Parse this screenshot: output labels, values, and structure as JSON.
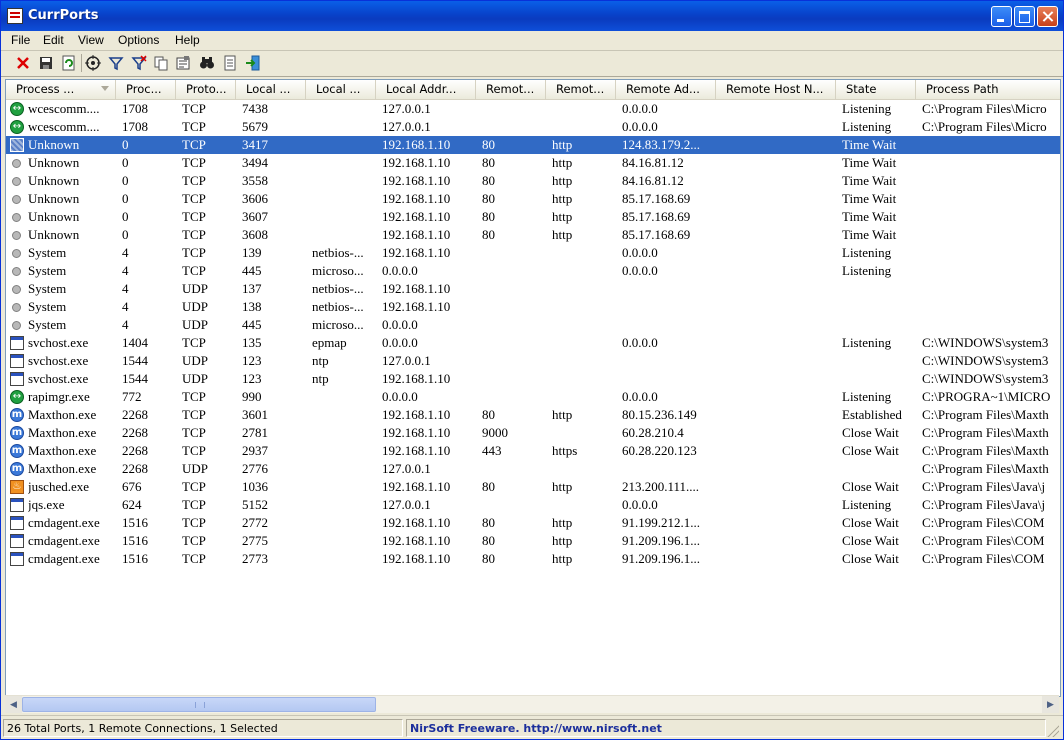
{
  "window": {
    "title": "CurrPorts"
  },
  "menu": [
    "File",
    "Edit",
    "View",
    "Options",
    "Help"
  ],
  "toolbar": [
    {
      "name": "close-connection-icon"
    },
    {
      "name": "save-icon"
    },
    {
      "name": "refresh-icon"
    },
    {
      "name": "target-icon"
    },
    {
      "name": "filter-icon"
    },
    {
      "name": "clear-filter-icon"
    },
    {
      "name": "copy-icon"
    },
    {
      "name": "properties-icon"
    },
    {
      "name": "find-icon"
    },
    {
      "name": "report-icon"
    },
    {
      "name": "exit-icon"
    }
  ],
  "columns": [
    "Process ...",
    "Proc...",
    "Proto...",
    "Local ...",
    "Local ...",
    "Local Addr...",
    "Remot...",
    "Remot...",
    "Remote Ad...",
    "Remote Host N...",
    "State",
    "Process Path"
  ],
  "rows": [
    {
      "icon": "green",
      "name": "wcescomm....",
      "pid": "1708",
      "proto": "TCP",
      "lport": "7438",
      "lpname": "",
      "laddr": "127.0.0.1",
      "rport": "",
      "rpname": "",
      "raddr": "0.0.0.0",
      "rhost": "",
      "state": "Listening",
      "path": "C:\\Program Files\\Micro"
    },
    {
      "icon": "green",
      "name": "wcescomm....",
      "pid": "1708",
      "proto": "TCP",
      "lport": "5679",
      "lpname": "",
      "laddr": "127.0.0.1",
      "rport": "",
      "rpname": "",
      "raddr": "0.0.0.0",
      "rhost": "",
      "state": "Listening",
      "path": "C:\\Program Files\\Micro"
    },
    {
      "icon": "unknown-sel",
      "name": "Unknown",
      "pid": "0",
      "proto": "TCP",
      "lport": "3417",
      "lpname": "",
      "laddr": "192.168.1.10",
      "rport": "80",
      "rpname": "http",
      "raddr": "124.83.179.2...",
      "rhost": "",
      "state": "Time Wait",
      "path": "",
      "selected": true
    },
    {
      "icon": "gray",
      "name": "Unknown",
      "pid": "0",
      "proto": "TCP",
      "lport": "3494",
      "lpname": "",
      "laddr": "192.168.1.10",
      "rport": "80",
      "rpname": "http",
      "raddr": "84.16.81.12",
      "rhost": "",
      "state": "Time Wait",
      "path": ""
    },
    {
      "icon": "gray",
      "name": "Unknown",
      "pid": "0",
      "proto": "TCP",
      "lport": "3558",
      "lpname": "",
      "laddr": "192.168.1.10",
      "rport": "80",
      "rpname": "http",
      "raddr": "84.16.81.12",
      "rhost": "",
      "state": "Time Wait",
      "path": ""
    },
    {
      "icon": "gray",
      "name": "Unknown",
      "pid": "0",
      "proto": "TCP",
      "lport": "3606",
      "lpname": "",
      "laddr": "192.168.1.10",
      "rport": "80",
      "rpname": "http",
      "raddr": "85.17.168.69",
      "rhost": "",
      "state": "Time Wait",
      "path": ""
    },
    {
      "icon": "gray",
      "name": "Unknown",
      "pid": "0",
      "proto": "TCP",
      "lport": "3607",
      "lpname": "",
      "laddr": "192.168.1.10",
      "rport": "80",
      "rpname": "http",
      "raddr": "85.17.168.69",
      "rhost": "",
      "state": "Time Wait",
      "path": ""
    },
    {
      "icon": "gray",
      "name": "Unknown",
      "pid": "0",
      "proto": "TCP",
      "lport": "3608",
      "lpname": "",
      "laddr": "192.168.1.10",
      "rport": "80",
      "rpname": "http",
      "raddr": "85.17.168.69",
      "rhost": "",
      "state": "Time Wait",
      "path": ""
    },
    {
      "icon": "gray",
      "name": "System",
      "pid": "4",
      "proto": "TCP",
      "lport": "139",
      "lpname": "netbios-...",
      "laddr": "192.168.1.10",
      "rport": "",
      "rpname": "",
      "raddr": "0.0.0.0",
      "rhost": "",
      "state": "Listening",
      "path": ""
    },
    {
      "icon": "gray",
      "name": "System",
      "pid": "4",
      "proto": "TCP",
      "lport": "445",
      "lpname": "microso...",
      "laddr": "0.0.0.0",
      "rport": "",
      "rpname": "",
      "raddr": "0.0.0.0",
      "rhost": "",
      "state": "Listening",
      "path": ""
    },
    {
      "icon": "gray",
      "name": "System",
      "pid": "4",
      "proto": "UDP",
      "lport": "137",
      "lpname": "netbios-...",
      "laddr": "192.168.1.10",
      "rport": "",
      "rpname": "",
      "raddr": "",
      "rhost": "",
      "state": "",
      "path": ""
    },
    {
      "icon": "gray",
      "name": "System",
      "pid": "4",
      "proto": "UDP",
      "lport": "138",
      "lpname": "netbios-...",
      "laddr": "192.168.1.10",
      "rport": "",
      "rpname": "",
      "raddr": "",
      "rhost": "",
      "state": "",
      "path": ""
    },
    {
      "icon": "gray",
      "name": "System",
      "pid": "4",
      "proto": "UDP",
      "lport": "445",
      "lpname": "microso...",
      "laddr": "0.0.0.0",
      "rport": "",
      "rpname": "",
      "raddr": "",
      "rhost": "",
      "state": "",
      "path": ""
    },
    {
      "icon": "win",
      "name": "svchost.exe",
      "pid": "1404",
      "proto": "TCP",
      "lport": "135",
      "lpname": "epmap",
      "laddr": "0.0.0.0",
      "rport": "",
      "rpname": "",
      "raddr": "0.0.0.0",
      "rhost": "",
      "state": "Listening",
      "path": "C:\\WINDOWS\\system3"
    },
    {
      "icon": "win",
      "name": "svchost.exe",
      "pid": "1544",
      "proto": "UDP",
      "lport": "123",
      "lpname": "ntp",
      "laddr": "127.0.0.1",
      "rport": "",
      "rpname": "",
      "raddr": "",
      "rhost": "",
      "state": "",
      "path": "C:\\WINDOWS\\system3"
    },
    {
      "icon": "win",
      "name": "svchost.exe",
      "pid": "1544",
      "proto": "UDP",
      "lport": "123",
      "lpname": "ntp",
      "laddr": "192.168.1.10",
      "rport": "",
      "rpname": "",
      "raddr": "",
      "rhost": "",
      "state": "",
      "path": "C:\\WINDOWS\\system3"
    },
    {
      "icon": "green",
      "name": "rapimgr.exe",
      "pid": "772",
      "proto": "TCP",
      "lport": "990",
      "lpname": "",
      "laddr": "0.0.0.0",
      "rport": "",
      "rpname": "",
      "raddr": "0.0.0.0",
      "rhost": "",
      "state": "Listening",
      "path": "C:\\PROGRA~1\\MICRO"
    },
    {
      "icon": "maxthon",
      "name": "Maxthon.exe",
      "pid": "2268",
      "proto": "TCP",
      "lport": "3601",
      "lpname": "",
      "laddr": "192.168.1.10",
      "rport": "80",
      "rpname": "http",
      "raddr": "80.15.236.149",
      "rhost": "",
      "state": "Established",
      "path": "C:\\Program Files\\Maxth"
    },
    {
      "icon": "maxthon",
      "name": "Maxthon.exe",
      "pid": "2268",
      "proto": "TCP",
      "lport": "2781",
      "lpname": "",
      "laddr": "192.168.1.10",
      "rport": "9000",
      "rpname": "",
      "raddr": "60.28.210.4",
      "rhost": "",
      "state": "Close Wait",
      "path": "C:\\Program Files\\Maxth"
    },
    {
      "icon": "maxthon",
      "name": "Maxthon.exe",
      "pid": "2268",
      "proto": "TCP",
      "lport": "2937",
      "lpname": "",
      "laddr": "192.168.1.10",
      "rport": "443",
      "rpname": "https",
      "raddr": "60.28.220.123",
      "rhost": "",
      "state": "Close Wait",
      "path": "C:\\Program Files\\Maxth"
    },
    {
      "icon": "maxthon",
      "name": "Maxthon.exe",
      "pid": "2268",
      "proto": "UDP",
      "lport": "2776",
      "lpname": "",
      "laddr": "127.0.0.1",
      "rport": "",
      "rpname": "",
      "raddr": "",
      "rhost": "",
      "state": "",
      "path": "C:\\Program Files\\Maxth"
    },
    {
      "icon": "java",
      "name": "jusched.exe",
      "pid": "676",
      "proto": "TCP",
      "lport": "1036",
      "lpname": "",
      "laddr": "192.168.1.10",
      "rport": "80",
      "rpname": "http",
      "raddr": "213.200.111....",
      "rhost": "",
      "state": "Close Wait",
      "path": "C:\\Program Files\\Java\\j"
    },
    {
      "icon": "win",
      "name": "jqs.exe",
      "pid": "624",
      "proto": "TCP",
      "lport": "5152",
      "lpname": "",
      "laddr": "127.0.0.1",
      "rport": "",
      "rpname": "",
      "raddr": "0.0.0.0",
      "rhost": "",
      "state": "Listening",
      "path": "C:\\Program Files\\Java\\j"
    },
    {
      "icon": "win",
      "name": "cmdagent.exe",
      "pid": "1516",
      "proto": "TCP",
      "lport": "2772",
      "lpname": "",
      "laddr": "192.168.1.10",
      "rport": "80",
      "rpname": "http",
      "raddr": "91.199.212.1...",
      "rhost": "",
      "state": "Close Wait",
      "path": "C:\\Program Files\\COM"
    },
    {
      "icon": "win",
      "name": "cmdagent.exe",
      "pid": "1516",
      "proto": "TCP",
      "lport": "2775",
      "lpname": "",
      "laddr": "192.168.1.10",
      "rport": "80",
      "rpname": "http",
      "raddr": "91.209.196.1...",
      "rhost": "",
      "state": "Close Wait",
      "path": "C:\\Program Files\\COM"
    },
    {
      "icon": "win",
      "name": "cmdagent.exe",
      "pid": "1516",
      "proto": "TCP",
      "lport": "2773",
      "lpname": "",
      "laddr": "192.168.1.10",
      "rport": "80",
      "rpname": "http",
      "raddr": "91.209.196.1...",
      "rhost": "",
      "state": "Close Wait",
      "path": "C:\\Program Files\\COM"
    }
  ],
  "status": {
    "summary": "26 Total Ports, 1 Remote Connections, 1 Selected",
    "link": "NirSoft Freeware.  http://www.nirsoft.net"
  }
}
